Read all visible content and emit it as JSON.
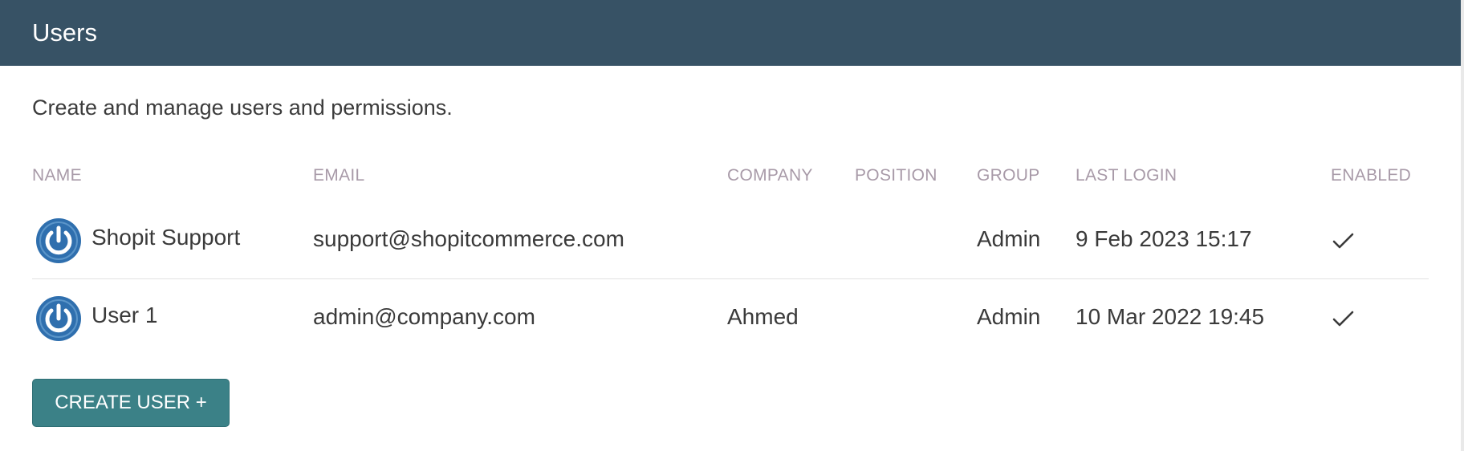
{
  "header": {
    "title": "Users"
  },
  "page": {
    "description": "Create and manage users and permissions."
  },
  "table": {
    "columns": {
      "name": "NAME",
      "email": "EMAIL",
      "company": "COMPANY",
      "position": "POSITION",
      "group": "GROUP",
      "last_login": "LAST LOGIN",
      "enabled": "ENABLED"
    },
    "rows": [
      {
        "avatar_icon": "power-icon",
        "name": "Shopit Support",
        "email": "support@shopitcommerce.com",
        "company": "",
        "position": "",
        "group": "Admin",
        "last_login": "9 Feb 2023 15:17",
        "enabled": true
      },
      {
        "avatar_icon": "power-icon",
        "name": "User 1",
        "email": "admin@company.com",
        "company": "Ahmed",
        "position": "",
        "group": "Admin",
        "last_login": "10 Mar 2022 19:45",
        "enabled": true
      }
    ]
  },
  "actions": {
    "create_user_label": "CREATE USER +"
  },
  "colors": {
    "header_bg": "#375265",
    "button_bg": "#3b8187",
    "avatar_blue": "#2f6fae",
    "column_header": "#a89aa8"
  }
}
